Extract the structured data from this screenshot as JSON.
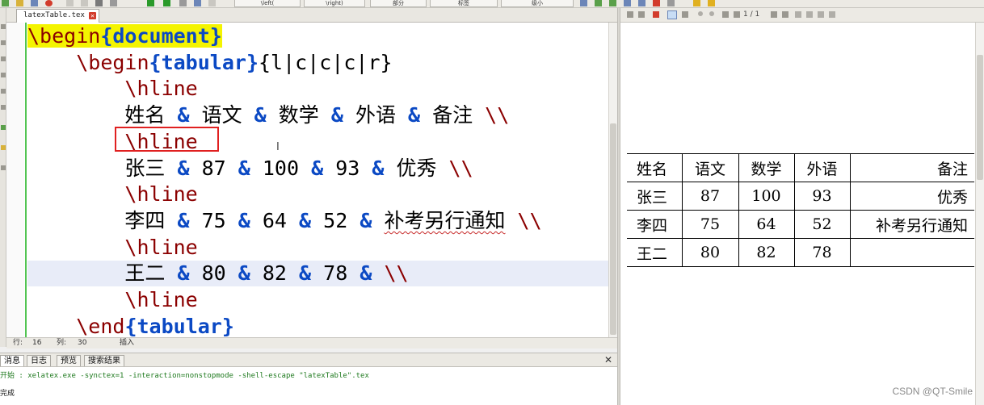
{
  "toolbar": {
    "left_label": "\\left(",
    "right_label": "\\right)",
    "menu1": "部分",
    "menu2": "标签",
    "menu3": "级小"
  },
  "editor": {
    "tab_name": "latexTable.tex",
    "tab_close": "✕",
    "lines": [
      {
        "indent": "",
        "parts": [
          [
            "cmd",
            "\\begin"
          ],
          [
            "kw",
            "{document}"
          ]
        ]
      },
      {
        "indent": "    ",
        "parts": [
          [
            "cmd",
            "\\begin"
          ],
          [
            "kw",
            "{tabular}"
          ],
          [
            "txt",
            "{l|c|c|c|r}"
          ]
        ]
      },
      {
        "indent": "        ",
        "parts": [
          [
            "cmd",
            "\\hline"
          ]
        ]
      },
      {
        "indent": "        ",
        "parts": [
          [
            "txt",
            "姓名 "
          ],
          [
            "amp",
            "&"
          ],
          [
            "txt",
            " 语文 "
          ],
          [
            "amp",
            "&"
          ],
          [
            "txt",
            " 数学 "
          ],
          [
            "amp",
            "&"
          ],
          [
            "txt",
            " 外语 "
          ],
          [
            "amp",
            "&"
          ],
          [
            "txt",
            " 备注 "
          ],
          [
            "bs",
            "\\\\"
          ]
        ]
      },
      {
        "indent": "        ",
        "parts": [
          [
            "cmd",
            "\\hline"
          ]
        ]
      },
      {
        "indent": "        ",
        "parts": [
          [
            "txt",
            "张三 "
          ],
          [
            "amp",
            "&"
          ],
          [
            "txt",
            " 87 "
          ],
          [
            "amp",
            "&"
          ],
          [
            "txt",
            " 100 "
          ],
          [
            "amp",
            "&"
          ],
          [
            "txt",
            " 93 "
          ],
          [
            "amp",
            "&"
          ],
          [
            "txt",
            " 优秀 "
          ],
          [
            "bs",
            "\\\\"
          ]
        ]
      },
      {
        "indent": "        ",
        "parts": [
          [
            "cmd",
            "\\hline"
          ]
        ]
      },
      {
        "indent": "        ",
        "parts": [
          [
            "txt",
            "李四 "
          ],
          [
            "amp",
            "&"
          ],
          [
            "txt",
            " 75 "
          ],
          [
            "amp",
            "&"
          ],
          [
            "txt",
            " 64 "
          ],
          [
            "amp",
            "&"
          ],
          [
            "txt",
            " 52 "
          ],
          [
            "amp",
            "&"
          ],
          [
            "txt",
            " "
          ],
          [
            "wavy",
            "补考另行通知"
          ],
          [
            "txt",
            " "
          ],
          [
            "bs",
            "\\\\"
          ]
        ]
      },
      {
        "indent": "        ",
        "parts": [
          [
            "cmd",
            "\\hline"
          ]
        ]
      },
      {
        "indent": "        ",
        "parts": [
          [
            "txt",
            "王二 "
          ],
          [
            "amp",
            "&"
          ],
          [
            "txt",
            " 80 "
          ],
          [
            "amp",
            "&"
          ],
          [
            "txt",
            " 82 "
          ],
          [
            "amp",
            "&"
          ],
          [
            "txt",
            " 78 "
          ],
          [
            "amp",
            "&"
          ],
          [
            "txt",
            " "
          ],
          [
            "bs",
            "\\\\"
          ]
        ]
      },
      {
        "indent": "        ",
        "parts": [
          [
            "cmd",
            "\\hline"
          ]
        ]
      },
      {
        "indent": "    ",
        "parts": [
          [
            "cmd",
            "\\end"
          ],
          [
            "kw",
            "{tabular}"
          ]
        ]
      }
    ],
    "cursor_glyph": "I"
  },
  "status": {
    "row_label": "行:",
    "row_value": "16",
    "col_label": "列:",
    "col_value": "30",
    "mode": "插入"
  },
  "bottom_panel": {
    "tabs": [
      "消息",
      "日志",
      "预览",
      "搜索结果"
    ],
    "close": "✕",
    "log_lines": [
      "开始 : xelatex.exe -synctex=1 -interaction=nonstopmode -shell-escape \"latexTable\".tex",
      "完成"
    ]
  },
  "pdf_viewer": {
    "page_indicator": "1 / 1",
    "table": {
      "header": [
        "姓名",
        "语文",
        "数学",
        "外语",
        "备注"
      ],
      "rows": [
        [
          "张三",
          "87",
          "100",
          "93",
          "优秀"
        ],
        [
          "李四",
          "75",
          "64",
          "52",
          "补考另行通知"
        ],
        [
          "王二",
          "80",
          "82",
          "78",
          ""
        ]
      ]
    }
  },
  "watermark": "CSDN @QT-Smile",
  "colors": {
    "keyword": "#0b49c4",
    "command": "#8b0000",
    "highlight": "#f4f400",
    "annotation_box": "#e02020",
    "current_line": "#e8ecf8"
  }
}
